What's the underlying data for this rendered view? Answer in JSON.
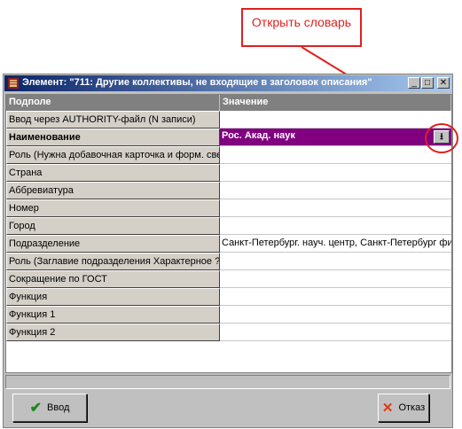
{
  "annotation": {
    "text": "Открыть словарь"
  },
  "window": {
    "title": "Элемент: \"711: Другие коллективы, не входящие в заголовок описания\"",
    "controls": {
      "minimize": "_",
      "maximize": "□",
      "close": "✕"
    }
  },
  "table": {
    "headers": [
      "Подполе",
      "Значение"
    ],
    "rows": [
      {
        "field": "Ввод через AUTHORITY-файл (N записи)",
        "value": ""
      },
      {
        "field": "Наименование",
        "value": "Рос. Акад. наук"
      },
      {
        "field": "Роль (Нужна добавочная карточка и форм. сведений)",
        "value": ""
      },
      {
        "field": "Страна",
        "value": ""
      },
      {
        "field": "Аббревиатура",
        "value": ""
      },
      {
        "field": "Номер",
        "value": ""
      },
      {
        "field": "Город",
        "value": ""
      },
      {
        "field": "Подразделение",
        "value": "Санкт-Петербург. науч. центр, Санкт-Петербург филиал"
      },
      {
        "field": "Роль (Заглавие подразделения Характерное ?)",
        "value": ""
      },
      {
        "field": "Сокращение по ГОСТ",
        "value": ""
      },
      {
        "field": "Функция",
        "value": ""
      },
      {
        "field": "Функция 1",
        "value": ""
      },
      {
        "field": "Функция 2",
        "value": ""
      }
    ],
    "selected_row": 1,
    "dictionary_button": "⭳"
  },
  "buttons": {
    "ok": "Ввод",
    "cancel": "Отказ"
  },
  "colors": {
    "selection": "#800080",
    "annotation": "#e02020",
    "header": "#808080"
  }
}
